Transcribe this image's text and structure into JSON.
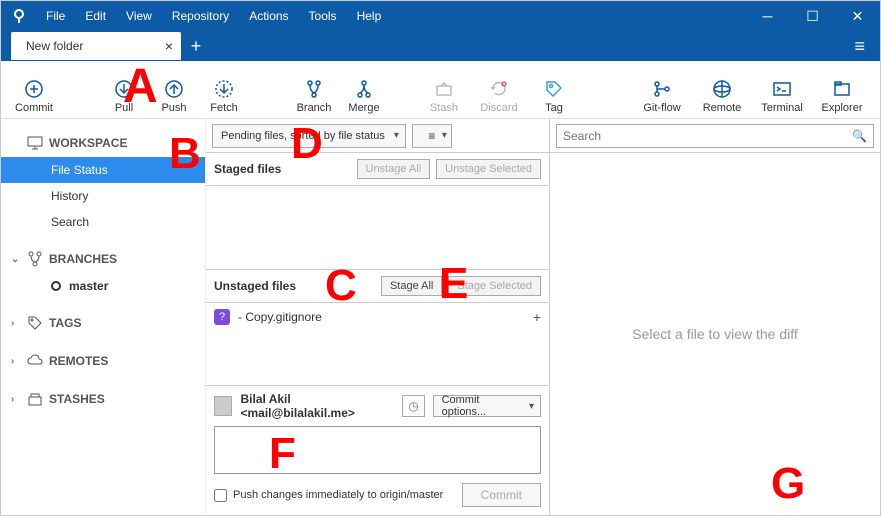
{
  "menu": {
    "file": "File",
    "edit": "Edit",
    "view": "View",
    "repository": "Repository",
    "actions": "Actions",
    "tools": "Tools",
    "help": "Help"
  },
  "tab": {
    "title": "New folder"
  },
  "toolbar": {
    "commit": "Commit",
    "pull": "Pull",
    "push": "Push",
    "fetch": "Fetch",
    "branch": "Branch",
    "merge": "Merge",
    "stash": "Stash",
    "discard": "Discard",
    "tag": "Tag",
    "gitflow": "Git-flow",
    "remote": "Remote",
    "terminal": "Terminal",
    "explorer": "Explorer"
  },
  "sidebar": {
    "workspace": "WORKSPACE",
    "file_status": "File Status",
    "history": "History",
    "search": "Search",
    "branches": "BRANCHES",
    "master": "master",
    "tags": "TAGS",
    "remotes": "REMOTES",
    "stashes": "STASHES"
  },
  "filter": {
    "mode": "Pending files, sorted by file status"
  },
  "staged": {
    "label": "Staged files",
    "unstage_all": "Unstage All",
    "unstage_selected": "Unstage Selected"
  },
  "unstaged": {
    "label": "Unstaged files",
    "stage_all": "Stage All",
    "stage_selected": "Stage Selected",
    "items": [
      {
        "badge": "?",
        "name": " - Copy.gitignore"
      }
    ]
  },
  "commit": {
    "author": "Bilal Akil <mail@bilalakil.me>",
    "options": "Commit options...",
    "push_label": "Push changes immediately to origin/master",
    "button": "Commit"
  },
  "search": {
    "placeholder": "Search"
  },
  "diff": {
    "placeholder": "Select a file to view the diff"
  },
  "overlays": {
    "A": "A",
    "B": "B",
    "C": "C",
    "D": "D",
    "E": "E",
    "F": "F",
    "G": "G"
  }
}
